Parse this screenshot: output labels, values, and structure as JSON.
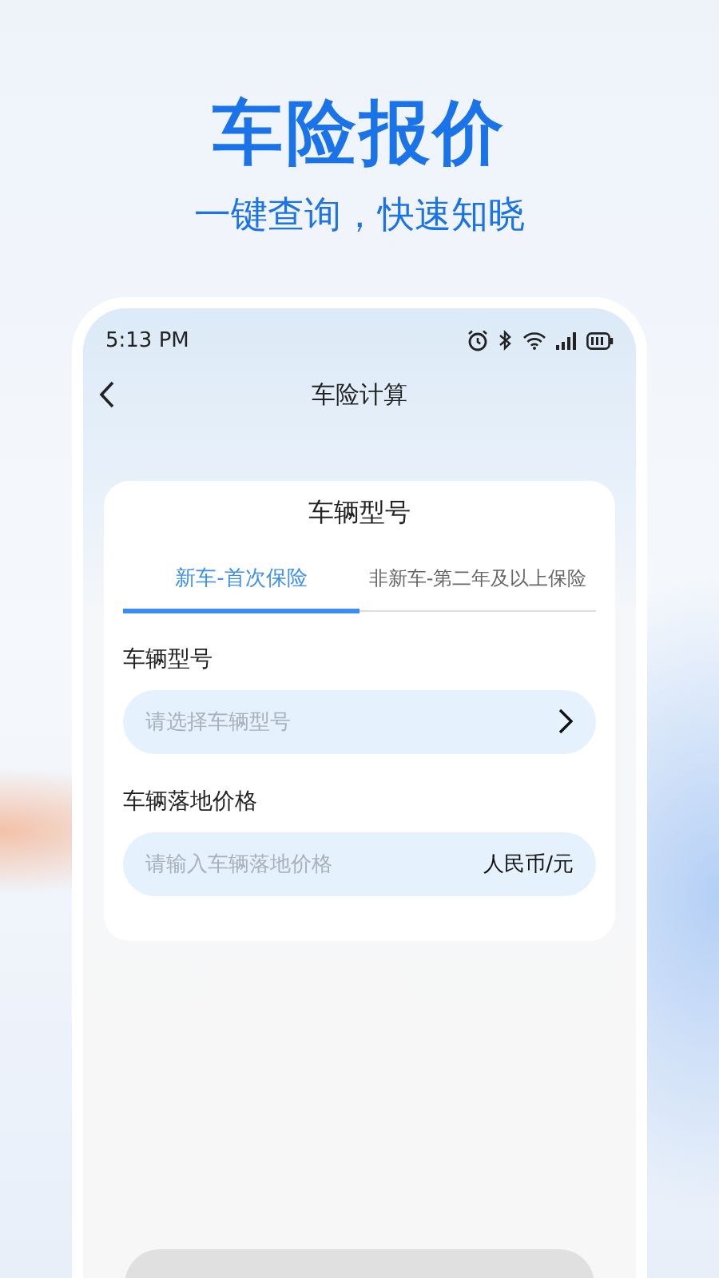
{
  "headline": {
    "title": "车险报价",
    "subtitle": "一键查询，快速知晓"
  },
  "status_bar": {
    "time": "5:13 PM"
  },
  "nav": {
    "title": "车险计算"
  },
  "card": {
    "title": "车辆型号",
    "tabs": [
      {
        "label": "新车-首次保险",
        "selected": true
      },
      {
        "label": "非新车-第二年及以上保险",
        "selected": false
      }
    ],
    "fields": [
      {
        "kind": "select",
        "label": "车辆型号",
        "placeholder": "请选择车辆型号"
      },
      {
        "kind": "input",
        "label": "车辆落地价格",
        "placeholder": "请输入车辆落地价格",
        "unit": "人民币/元"
      }
    ]
  },
  "calculate_button": {
    "disabled": true
  }
}
